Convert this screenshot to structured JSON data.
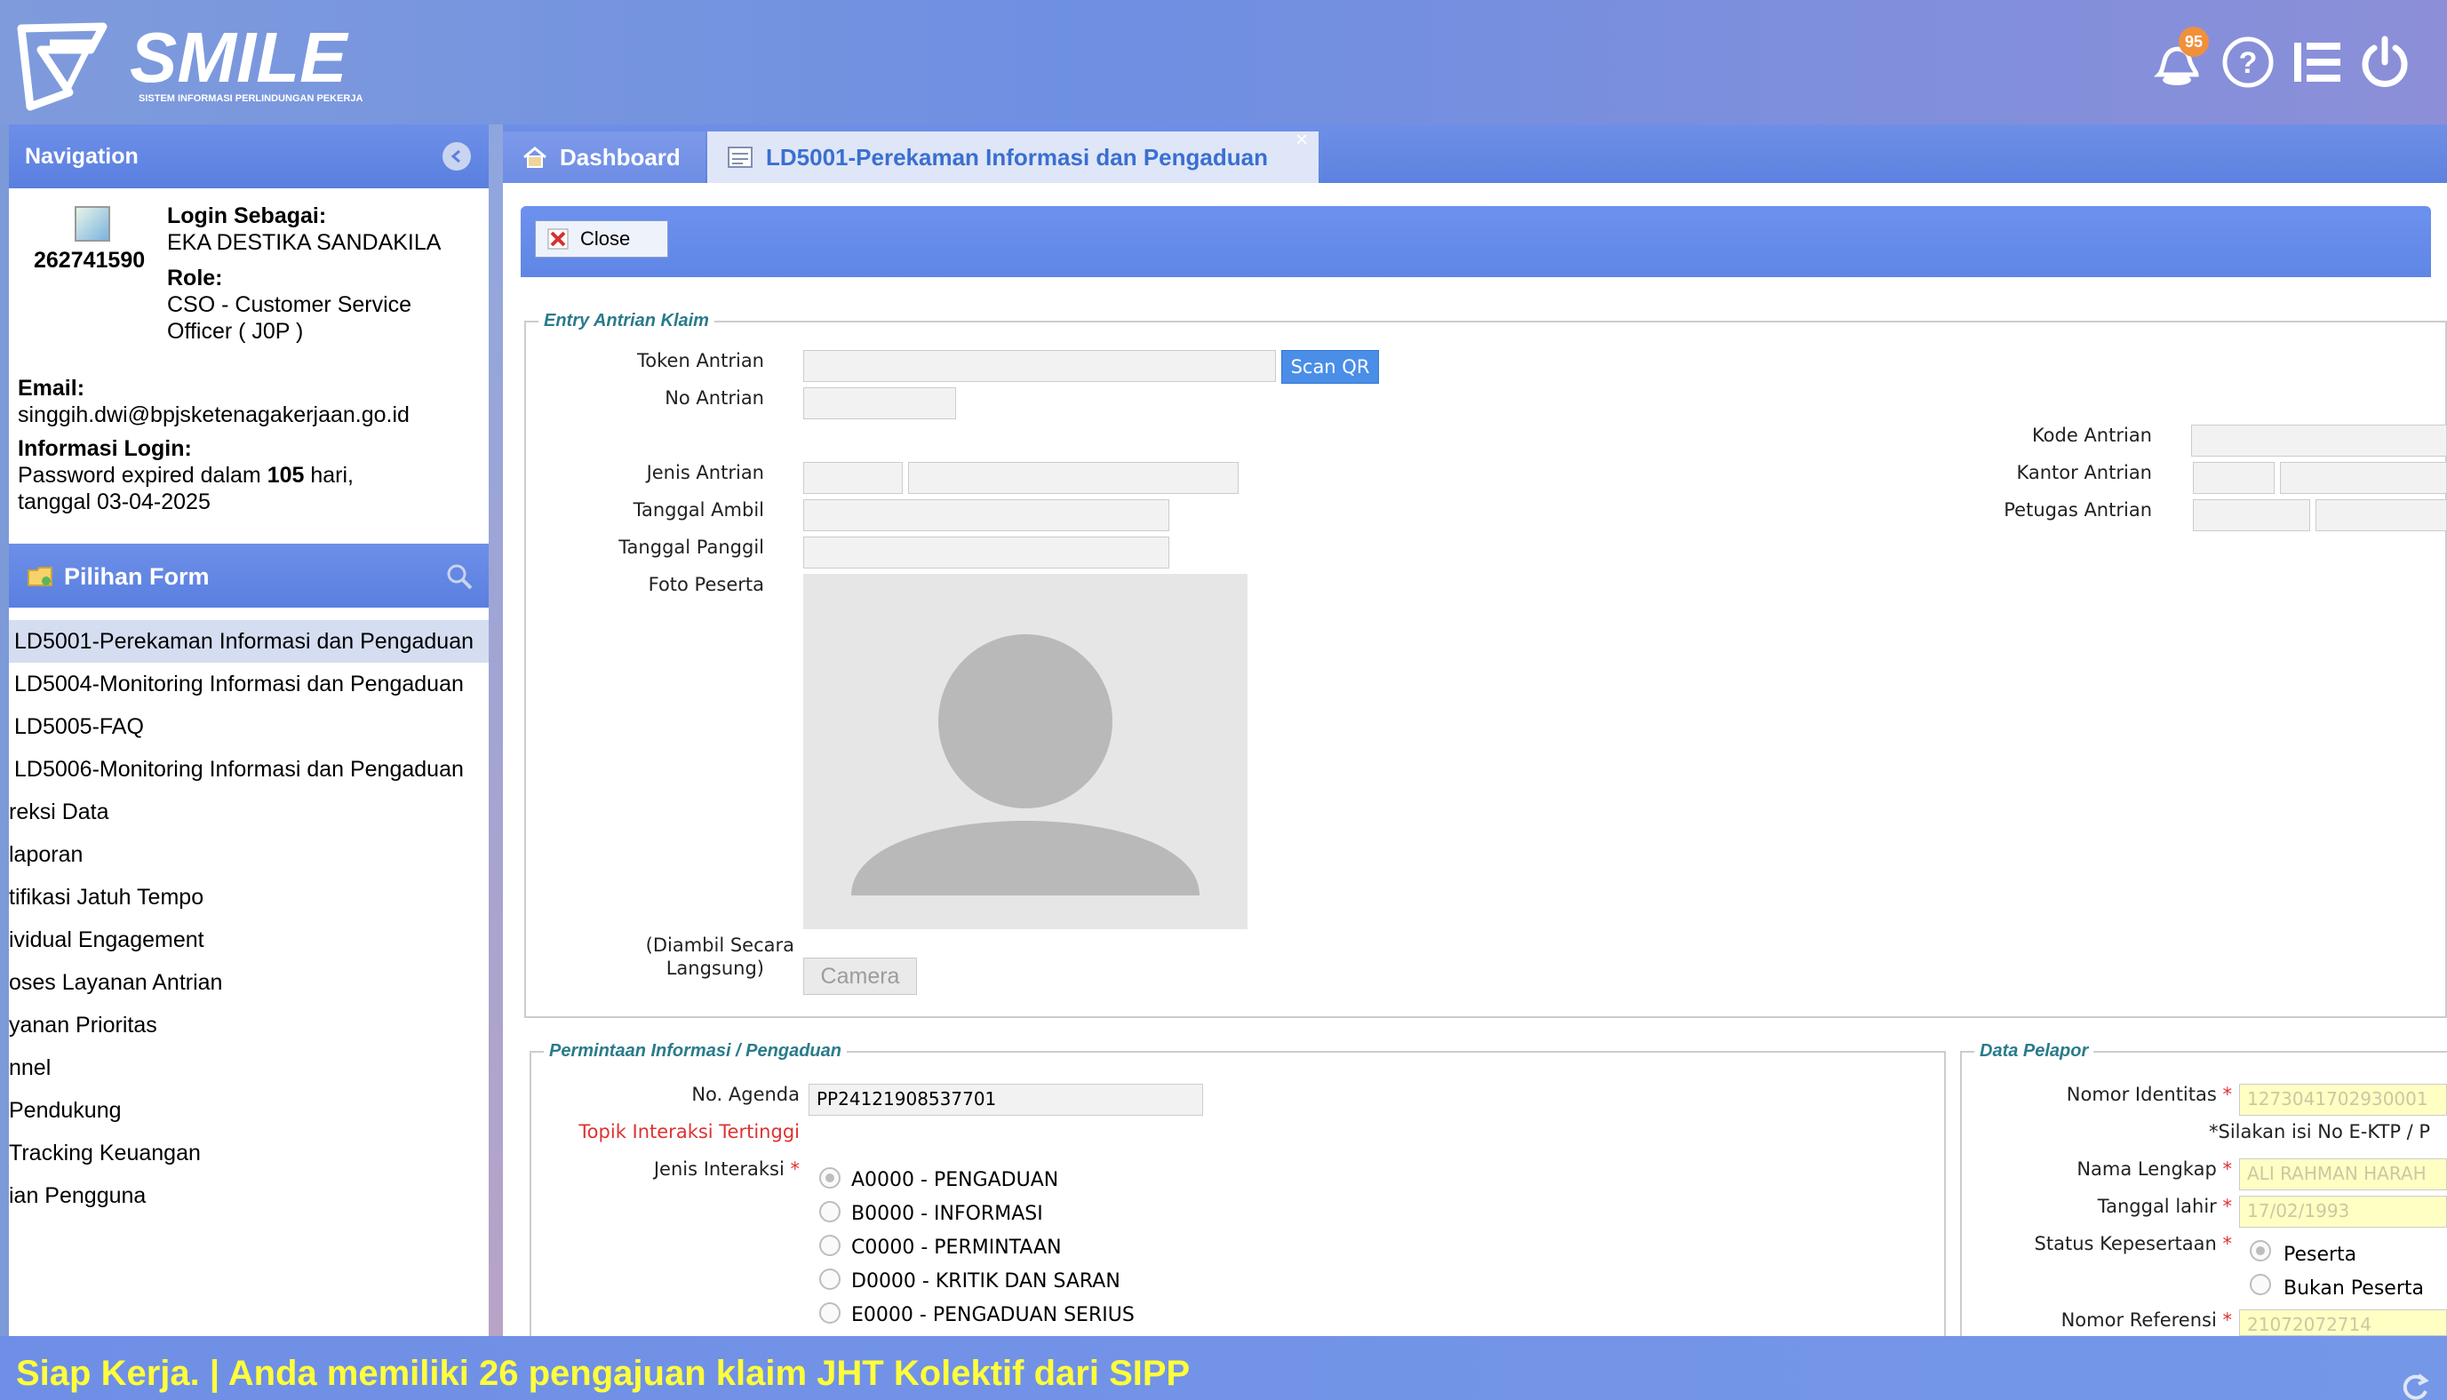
{
  "header": {
    "logo_text": "SMILE",
    "logo_subtitle": "SISTEM INFORMASI PERLINDUNGAN PEKERJA",
    "notification_count": "95"
  },
  "nav": {
    "title": "Navigation",
    "user_id": "262741590",
    "login_as_label": "Login Sebagai:",
    "user_name": "EKA DESTIKA SANDAKILA",
    "role_label": "Role:",
    "role_line1": "CSO - Customer Service",
    "role_line2": "Officer ( J0P )",
    "email_label": "Email:",
    "email": "singgih.dwi@bpjsketenagakerjaan.go.id",
    "login_info_label": "Informasi Login:",
    "pw_prefix": "Password expired dalam ",
    "pw_days": "105",
    "pw_suffix": " hari,",
    "pw_date": "tanggal 03-04-2025"
  },
  "pilihan_form": {
    "title": "Pilihan Form",
    "items": [
      "LD5001-Perekaman Informasi dan Pengaduan",
      "LD5004-Monitoring Informasi dan Pengaduan",
      "LD5005-FAQ",
      "LD5006-Monitoring Informasi dan Pengaduan",
      "reksi Data",
      "laporan",
      "tifikasi Jatuh Tempo",
      "ividual Engagement",
      "oses Layanan Antrian",
      "yanan Prioritas",
      "nnel",
      "Pendukung",
      "Tracking Keuangan",
      "ian Pengguna"
    ]
  },
  "tabs": {
    "dashboard": "Dashboard",
    "active": "LD5001-Perekaman Informasi dan Pengaduan",
    "close_x": "×"
  },
  "toolbar": {
    "close_label": "Close"
  },
  "entry": {
    "legend": "Entry Antrian Klaim",
    "token_label": "Token Antrian",
    "scan_label": "Scan QR",
    "no_antrian_label": "No Antrian",
    "kode_antrian_label": "Kode Antrian",
    "jenis_antrian_label": "Jenis Antrian",
    "kantor_antrian_label": "Kantor Antrian",
    "tanggal_ambil_label": "Tanggal Ambil",
    "petugas_antrian_label": "Petugas Antrian",
    "tanggal_panggil_label": "Tanggal Panggil",
    "foto_label": "Foto Peserta",
    "diambil_line1": "(Diambil Secara",
    "diambil_line2": "Langsung)",
    "camera_label": "Camera"
  },
  "permintaan": {
    "legend": "Permintaan Informasi / Pengaduan",
    "no_agenda_label": "No. Agenda",
    "no_agenda_value": "PP24121908537701",
    "topik_label": "Topik Interaksi Tertinggi",
    "jenis_label": "Jenis Interaksi",
    "options": [
      "A0000 - PENGADUAN",
      "B0000 - INFORMASI",
      "C0000 - PERMINTAAN",
      "D0000 - KRITIK DAN SARAN",
      "E0000 - PENGADUAN SERIUS"
    ]
  },
  "pelapor": {
    "legend": "Data Pelapor",
    "nomor_identitas_label": "Nomor Identitas",
    "nomor_identitas_value": "1273041702930001",
    "hint": "*Silakan isi No E-KTP / P",
    "nama_label": "Nama Lengkap",
    "nama_value": "ALI RAHMAN HARAH",
    "tgl_lahir_label": "Tanggal lahir",
    "tgl_lahir_value": "17/02/1993",
    "status_label": "Status Kepesertaan",
    "status_options": [
      "Peserta",
      "Bukan Peserta"
    ],
    "nomor_ref_label": "Nomor Referensi",
    "nomor_ref_value": "21072072714"
  },
  "footer": {
    "ticker": "Siap Kerja. | Anda memiliki 26 pengajuan klaim JHT Kolektif dari SIPP"
  }
}
